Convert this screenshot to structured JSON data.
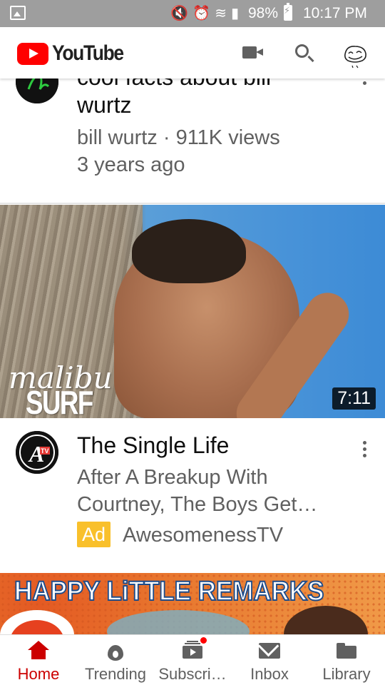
{
  "status_bar": {
    "battery": "98%",
    "time": "10:17 PM",
    "icons": [
      "image-icon",
      "mute-icon",
      "alarm-icon",
      "wifi-icon",
      "signal-icon",
      "battery-charging-icon"
    ]
  },
  "app_bar": {
    "logo_text": "YouTube",
    "actions": [
      "camera-icon",
      "search-icon",
      "account-avatar"
    ]
  },
  "feed": {
    "video1": {
      "title_line1": "cool facts about bill",
      "title_line2": "wurtz",
      "channel_views": "bill wurtz · 911K views",
      "age": "3 years ago"
    },
    "ad": {
      "thumb_brand_script": "malibu",
      "thumb_brand_block": "SURF",
      "duration": "7:11",
      "title": "The Single Life",
      "desc_line1": "After A Breakup With",
      "desc_line2": "Courtney, The Boys Get…",
      "badge": "Ad",
      "channel": "AwesomenessTV",
      "channel_logo_text": "A",
      "channel_logo_sub": "TV"
    },
    "next": {
      "banner_title": "HAPPY LiTTLE REMARKS"
    }
  },
  "bottom_nav": [
    {
      "label": "Home",
      "icon": "home-icon",
      "active": true
    },
    {
      "label": "Trending",
      "icon": "trending-icon",
      "active": false
    },
    {
      "label": "Subscri…",
      "icon": "subscriptions-icon",
      "active": false
    },
    {
      "label": "Inbox",
      "icon": "inbox-icon",
      "active": false
    },
    {
      "label": "Library",
      "icon": "library-icon",
      "active": false
    }
  ],
  "colors": {
    "brand_red": "#ff0000",
    "active_nav": "#cc0000",
    "ad_badge": "#f9c02b",
    "status_bar": "#9e9e9e"
  }
}
